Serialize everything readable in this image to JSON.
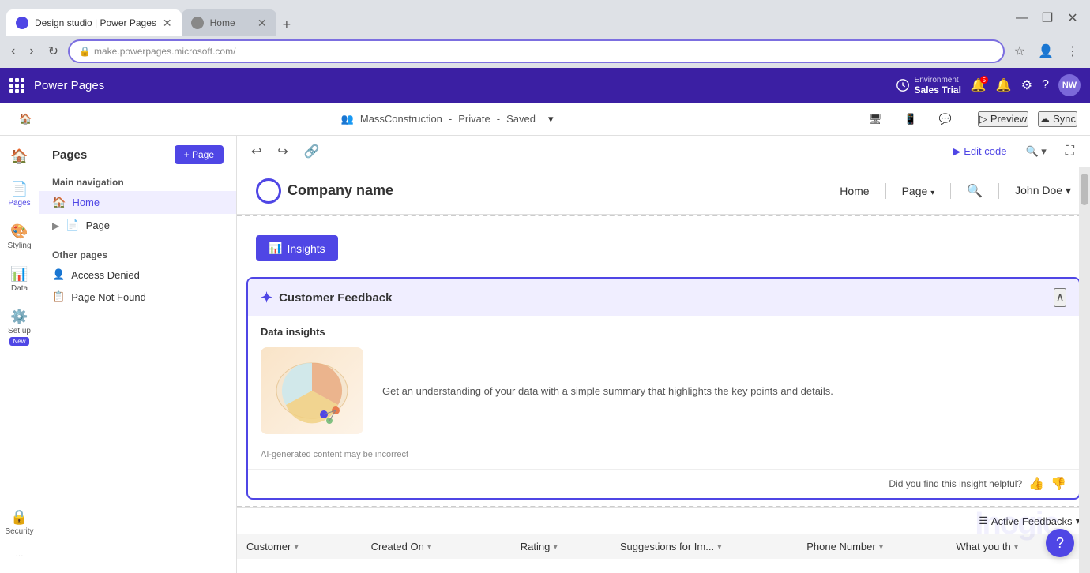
{
  "browser": {
    "tabs": [
      {
        "id": "tab1",
        "label": "Design studio | Power Pages",
        "active": true,
        "favicon_type": "pp"
      },
      {
        "id": "tab2",
        "label": "Home",
        "active": false,
        "favicon_type": "globe"
      }
    ],
    "address": "make.powerpages.microsoft.com/",
    "new_tab_label": "+"
  },
  "app": {
    "logo": "Power Pages",
    "environment_label": "Environment",
    "environment_name": "Sales Trial",
    "notification_count": "5",
    "avatar_initials": "NW"
  },
  "subheader": {
    "site_name": "MassConstruction",
    "site_visibility": "Private",
    "site_status": "Saved",
    "preview_label": "Preview",
    "sync_label": "Sync"
  },
  "left_nav": {
    "items": [
      {
        "id": "home",
        "icon": "🏠",
        "label": ""
      },
      {
        "id": "pages",
        "icon": "📄",
        "label": "Pages",
        "active": true
      },
      {
        "id": "styling",
        "icon": "🎨",
        "label": "Styling"
      },
      {
        "id": "data",
        "icon": "📊",
        "label": "Data"
      },
      {
        "id": "setup",
        "icon": "⚙️",
        "label": "Set up"
      },
      {
        "id": "security",
        "icon": "🔒",
        "label": "Security"
      }
    ]
  },
  "pages_panel": {
    "title": "Pages",
    "add_button": "+ Page",
    "main_nav_label": "Main navigation",
    "pages": [
      {
        "id": "home",
        "label": "Home",
        "active": true,
        "icon": "🏠"
      },
      {
        "id": "page",
        "label": "Page",
        "active": false,
        "icon": "📄",
        "expandable": true
      }
    ],
    "other_pages_label": "Other pages",
    "other_pages": [
      {
        "id": "access-denied",
        "label": "Access Denied",
        "icon": "👤"
      },
      {
        "id": "not-found",
        "label": "Page Not Found",
        "icon": "📋"
      }
    ]
  },
  "toolbar": {
    "undo_label": "Undo",
    "redo_label": "Redo",
    "link_label": "Link",
    "edit_code_label": "Edit code",
    "zoom_label": "🔍",
    "fullscreen_label": "⛶"
  },
  "site_preview": {
    "logo_text": "Company name",
    "nav_links": [
      "Home",
      "Page",
      "John Doe"
    ],
    "nav_has_search": true
  },
  "insights_section": {
    "tab_label": "Insights",
    "tab_icon": "📊",
    "card_title": "Customer Feedback",
    "card_icon": "✦",
    "section_label": "Data insights",
    "description": "Get an understanding of your data with a simple summary that highlights the key points and details.",
    "ai_disclaimer": "AI-generated content may be incorrect",
    "helpful_text": "Did you find this insight helpful?",
    "thumbs_up": "👍",
    "thumbs_down": "👎"
  },
  "table": {
    "active_feedbacks_label": "Active Feedbacks",
    "columns": [
      {
        "id": "customer",
        "label": "Customer",
        "sortable": true
      },
      {
        "id": "created_on",
        "label": "Created On",
        "sortable": true
      },
      {
        "id": "rating",
        "label": "Rating",
        "sortable": true
      },
      {
        "id": "suggestions",
        "label": "Suggestions for Im...",
        "sortable": true
      },
      {
        "id": "phone",
        "label": "Phone Number",
        "sortable": true
      },
      {
        "id": "what_you",
        "label": "What you th",
        "sortable": true
      }
    ]
  },
  "watermark": "Inogic",
  "help_icon": "?"
}
